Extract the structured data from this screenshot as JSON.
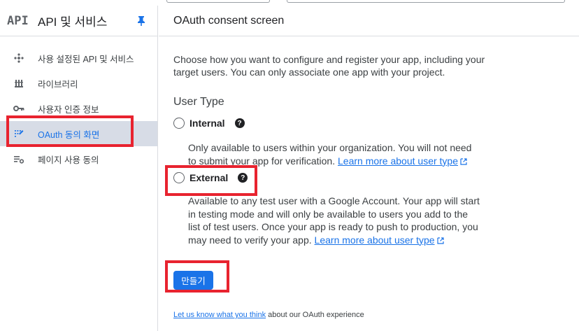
{
  "sidebar": {
    "logo": "API",
    "title": "API 및 서비스",
    "items": [
      {
        "label": "사용 설정된 API 및 서비스",
        "icon": "diamond-icon",
        "active": false
      },
      {
        "label": "라이브러리",
        "icon": "library-icon",
        "active": false
      },
      {
        "label": "사용자 인증 정보",
        "icon": "key-icon",
        "active": false
      },
      {
        "label": "OAuth 동의 화면",
        "icon": "oauth-icon",
        "active": true
      },
      {
        "label": "페이지 사용 동의",
        "icon": "settings-list-icon",
        "active": false
      }
    ]
  },
  "main": {
    "title": "OAuth consent screen",
    "intro": "Choose how you want to configure and register your app, including your target users. You can only associate one app with your project.",
    "user_type_title": "User Type",
    "internal": {
      "label": "Internal",
      "description": "Only available to users within your organization. You will not need to submit your app for verification.",
      "link": "Learn more about user type"
    },
    "external": {
      "label": "External",
      "description": "Available to any test user with a Google Account. Your app will start in testing mode and will only be available to users you add to the list of test users. Once your app is ready to push to production, you may need to verify your app.",
      "link": "Learn more about user type"
    },
    "create_button": "만들기",
    "feedback_link": "Let us know what you think",
    "feedback_text": " about our OAuth experience"
  },
  "colors": {
    "accent": "#1a73e8",
    "highlight_border": "#e8232f",
    "active_nav_bg": "#d7dce6"
  }
}
